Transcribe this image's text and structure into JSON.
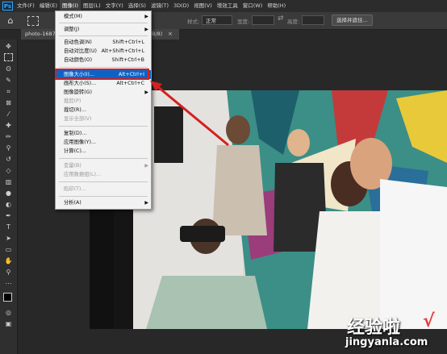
{
  "app": {
    "logo": "Ps",
    "colors": {
      "accent": "#31a8ff",
      "highlight": "#0a64c8",
      "annotation": "#d42020"
    }
  },
  "menubar": {
    "items": [
      {
        "label": "文件(F)"
      },
      {
        "label": "编辑(E)"
      },
      {
        "label": "图像(I)"
      },
      {
        "label": "图层(L)"
      },
      {
        "label": "文字(Y)"
      },
      {
        "label": "选择(S)"
      },
      {
        "label": "滤镜(T)"
      },
      {
        "label": "3D(D)"
      },
      {
        "label": "视图(V)"
      },
      {
        "label": "增效工具"
      },
      {
        "label": "窗口(W)"
      },
      {
        "label": "帮助(H)"
      }
    ]
  },
  "options": {
    "style_label": "样式:",
    "style_value": "正常",
    "width_label": "宽度:",
    "height_label": "高度:",
    "select_mask_label": "选择并遮住..."
  },
  "document": {
    "tab_title": "photo-168725",
    "tab_tail": "B/8)",
    "close_glyph": "×"
  },
  "image_menu": {
    "items": [
      {
        "label": "模式(M)",
        "submenu": true
      },
      {
        "label": "调整(J)",
        "submenu": true
      },
      {
        "label": "自动色调(N)",
        "shortcut": "Shift+Ctrl+L"
      },
      {
        "label": "自动对比度(U)",
        "shortcut": "Alt+Shift+Ctrl+L"
      },
      {
        "label": "自动颜色(O)",
        "shortcut": "Shift+Ctrl+B"
      },
      {
        "label": "图像大小(I)...",
        "shortcut": "Alt+Ctrl+I",
        "highlighted": true
      },
      {
        "label": "画布大小(S)...",
        "shortcut": "Alt+Ctrl+C"
      },
      {
        "label": "图像旋转(G)",
        "submenu": true
      },
      {
        "label": "裁剪(P)",
        "disabled": true
      },
      {
        "label": "裁切(R)..."
      },
      {
        "label": "显示全部(V)",
        "disabled": true
      },
      {
        "label": "复制(D)..."
      },
      {
        "label": "应用图像(Y)..."
      },
      {
        "label": "计算(C)..."
      },
      {
        "label": "变量(B)",
        "submenu": true,
        "disabled": true
      },
      {
        "label": "应用数据组(L)...",
        "disabled": true
      },
      {
        "label": "陷印(T)...",
        "disabled": true
      },
      {
        "label": "分析(A)",
        "submenu": true
      }
    ]
  },
  "watermark": {
    "text": "经验啦",
    "url": "jingyanla.com",
    "check": "√"
  }
}
